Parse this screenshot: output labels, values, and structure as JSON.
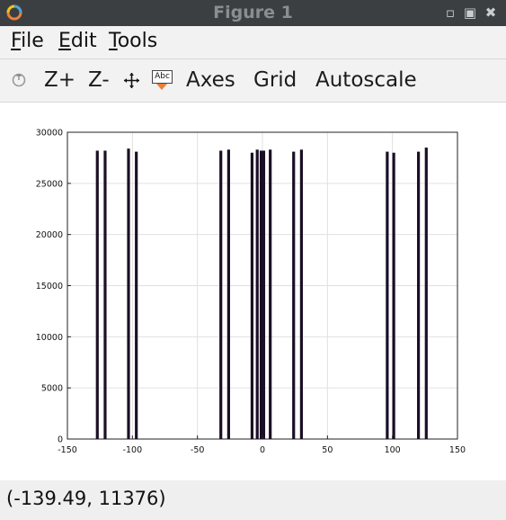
{
  "window": {
    "title": "Figure 1",
    "controls": [
      "minimize",
      "maximize",
      "close"
    ]
  },
  "menu": [
    {
      "accel": "F",
      "rest": "ile"
    },
    {
      "accel": "E",
      "rest": "dit"
    },
    {
      "accel": "T",
      "rest": "ools"
    }
  ],
  "toolbar": {
    "zoom_in": "Z+",
    "zoom_out": "Z-",
    "pan_icon": "move-arrows-icon",
    "text_icon_label": "Abc",
    "axes": "Axes",
    "grid": "Grid",
    "autoscale": "Autoscale"
  },
  "status": {
    "coords": "(-139.49, 11376)"
  },
  "colors": {
    "bar": "#1b0f26",
    "titlebar": "#3c3f41",
    "grid": "#e0e0e0"
  },
  "chart_data": {
    "type": "bar",
    "xlim": [
      -150,
      150
    ],
    "ylim": [
      0,
      30000
    ],
    "xticks": [
      -150,
      -100,
      -50,
      0,
      50,
      100,
      150
    ],
    "yticks": [
      0,
      5000,
      10000,
      15000,
      20000,
      25000,
      30000
    ],
    "grid": true,
    "x": [
      -127,
      -121,
      -103,
      -97,
      -32,
      -26,
      -8,
      -4,
      -1,
      1,
      6,
      24,
      30,
      96,
      101,
      120,
      126
    ],
    "values": [
      28200,
      28200,
      28400,
      28100,
      28200,
      28300,
      28000,
      28300,
      28200,
      28200,
      28300,
      28100,
      28300,
      28100,
      28000,
      28100,
      28500
    ]
  }
}
